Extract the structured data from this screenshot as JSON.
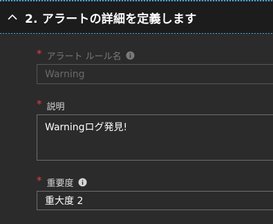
{
  "section": {
    "title": "2. アラートの詳細を定義します",
    "collapse_icon": "chevron-up-icon"
  },
  "fields": {
    "rule_name": {
      "label": "アラート ルール名",
      "value": "Warning",
      "required_marker": "*",
      "info_icon": "info-icon"
    },
    "description": {
      "label": "説明",
      "value": "Warningログ発見!",
      "required_marker": "*"
    },
    "severity": {
      "label": "重要度",
      "value": "重大度 2",
      "required_marker": "*",
      "info_icon": "info-icon"
    }
  },
  "colors": {
    "background": "#2b2b2b",
    "header_background": "#1c1c1c",
    "required": "#e0403c",
    "accent_dashes": "#4aa3df"
  }
}
